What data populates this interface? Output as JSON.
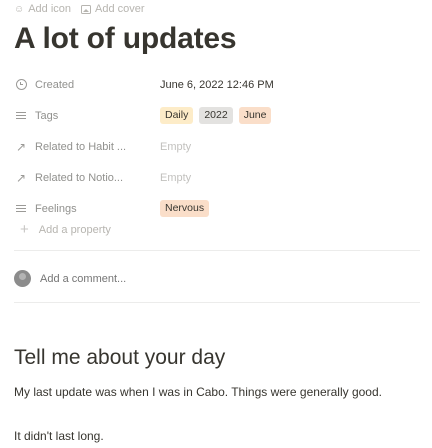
{
  "top_actions": {
    "add_icon": "Add icon",
    "add_cover": "Add cover"
  },
  "page": {
    "title": "A lot of updates"
  },
  "properties": [
    {
      "icon": "clock-icon",
      "name": "Created",
      "value": "June 6, 2022 12:46 PM"
    },
    {
      "icon": "list-icon",
      "name": "Tags",
      "tags": [
        {
          "label": "Daily",
          "color": "#fdecc8"
        },
        {
          "label": "2022",
          "color": "#e3e2e0"
        },
        {
          "label": "June",
          "color": "#fadec9"
        }
      ]
    },
    {
      "icon": "relation-arrow-icon",
      "name": "Related to Habit ...",
      "value": "Empty"
    },
    {
      "icon": "relation-arrow-icon",
      "name": "Related to Notio...",
      "value": "Empty"
    },
    {
      "icon": "list-icon",
      "name": "Feelings",
      "tags": [
        {
          "label": "Nervous",
          "color": "#fadec9"
        }
      ]
    }
  ],
  "add_property": "Add a property",
  "comment": {
    "placeholder": "Add a comment..."
  },
  "content": {
    "heading": "Tell me about your day",
    "paragraph1": "My last update was when I was in Cabo. Things were generally good.",
    "paragraph2": "It didn't last long."
  }
}
